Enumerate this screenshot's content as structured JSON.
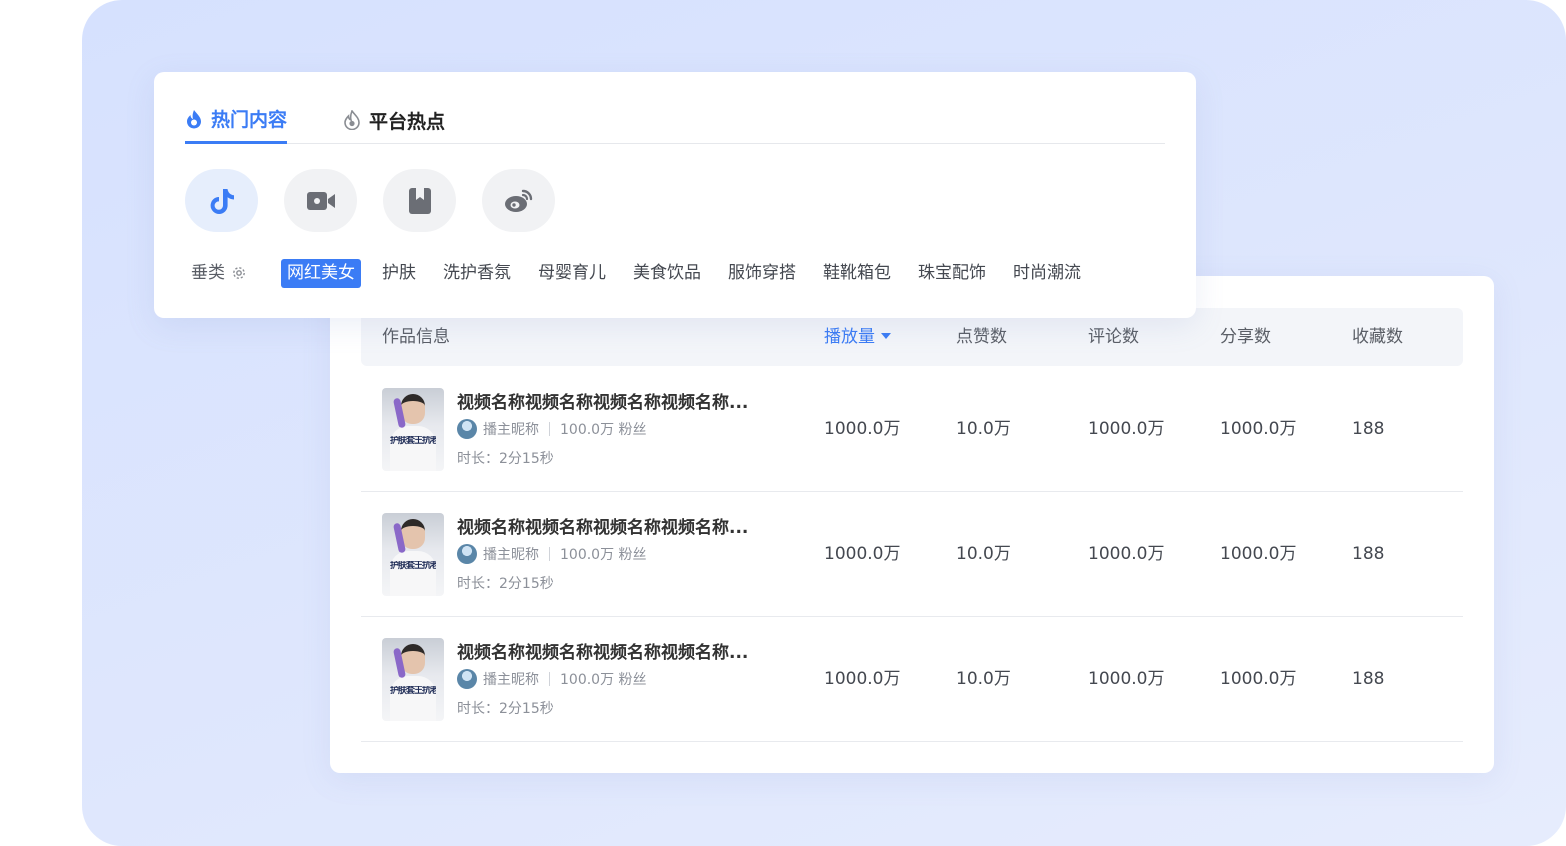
{
  "colors": {
    "accent": "#3b7cf5",
    "panel_bg": "#d6e1fe"
  },
  "tabs": [
    {
      "label": "热门内容",
      "icon": "flame-icon",
      "active": true
    },
    {
      "label": "平台热点",
      "icon": "fire-icon",
      "active": false
    }
  ],
  "platforms": [
    {
      "icon": "tiktok-icon",
      "active": true
    },
    {
      "icon": "video-camera-icon",
      "active": false
    },
    {
      "icon": "bookmark-icon",
      "active": false
    },
    {
      "icon": "weibo-icon",
      "active": false
    }
  ],
  "categories": {
    "label": "垂类",
    "settings_icon": "gear-icon",
    "items": [
      "网红美女",
      "护肤",
      "洗护香氛",
      "母婴育儿",
      "美食饮品",
      "服饰穿搭",
      "鞋靴箱包",
      "珠宝配饰",
      "时尚潮流"
    ],
    "selected": "网红美女"
  },
  "table": {
    "headers": [
      "作品信息",
      "播放量",
      "点赞数",
      "评论数",
      "分享数",
      "收藏数"
    ],
    "sort_column": "播放量",
    "rows": [
      {
        "title": "视频名称视频名称视频名称视频名称...",
        "thumb_caption": "护肤套王抗老更亮！",
        "author": "播主昵称",
        "fans": "100.0万 粉丝",
        "duration": "时长：2分15秒",
        "plays": "1000.0万",
        "likes": "10.0万",
        "comments": "1000.0万",
        "shares": "1000.0万",
        "favorites": "188"
      },
      {
        "title": "视频名称视频名称视频名称视频名称...",
        "thumb_caption": "护肤套王抗老更亮！",
        "author": "播主昵称",
        "fans": "100.0万 粉丝",
        "duration": "时长：2分15秒",
        "plays": "1000.0万",
        "likes": "10.0万",
        "comments": "1000.0万",
        "shares": "1000.0万",
        "favorites": "188"
      },
      {
        "title": "视频名称视频名称视频名称视频名称...",
        "thumb_caption": "护肤套王抗老更亮！",
        "author": "播主昵称",
        "fans": "100.0万 粉丝",
        "duration": "时长：2分15秒",
        "plays": "1000.0万",
        "likes": "10.0万",
        "comments": "1000.0万",
        "shares": "1000.0万",
        "favorites": "188"
      }
    ]
  }
}
